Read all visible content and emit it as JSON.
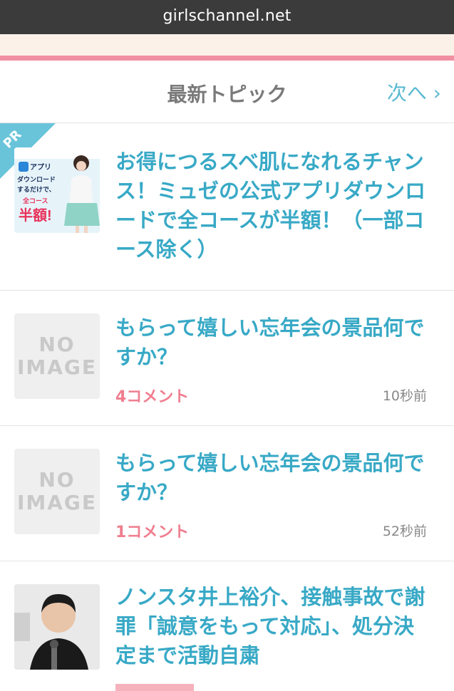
{
  "browser": {
    "url": "girlschannel.net"
  },
  "header": {
    "title": "最新トピック",
    "next_label": "次へ ›"
  },
  "pr_item": {
    "badge": "PR",
    "title": "お得につるスベ肌になれるチャンス！ミュゼの公式アプリダウンロードで全コースが半額！（一部コース除く）",
    "ad_image": {
      "line1": "アプリ",
      "line2": "ダウンロード",
      "line3": "するだけで、",
      "line4": "全コース",
      "line5": "半額!",
      "colors": {
        "bg": "#dff0f8",
        "accent": "#e8325a"
      }
    }
  },
  "topics": [
    {
      "thumb": {
        "line1": "NO",
        "line2": "IMAGE"
      },
      "title": "もらって嬉しい忘年会の景品何ですか？",
      "comments": "4コメント",
      "time": "10秒前"
    },
    {
      "thumb": {
        "line1": "NO",
        "line2": "IMAGE"
      },
      "title": "もらって嬉しい忘年会の景品何ですか？",
      "comments": "1コメント",
      "time": "52秒前"
    },
    {
      "title": "ノンスタ井上裕介、接触事故で謝罪「誠意をもって対応」、処分決定まで活動自粛"
    }
  ],
  "colors": {
    "title_blue": "#38a9c6",
    "comment_pink": "#f07e8f",
    "accent_pink_line": "#f18fa3",
    "header_gray": "#7a7a7a"
  }
}
